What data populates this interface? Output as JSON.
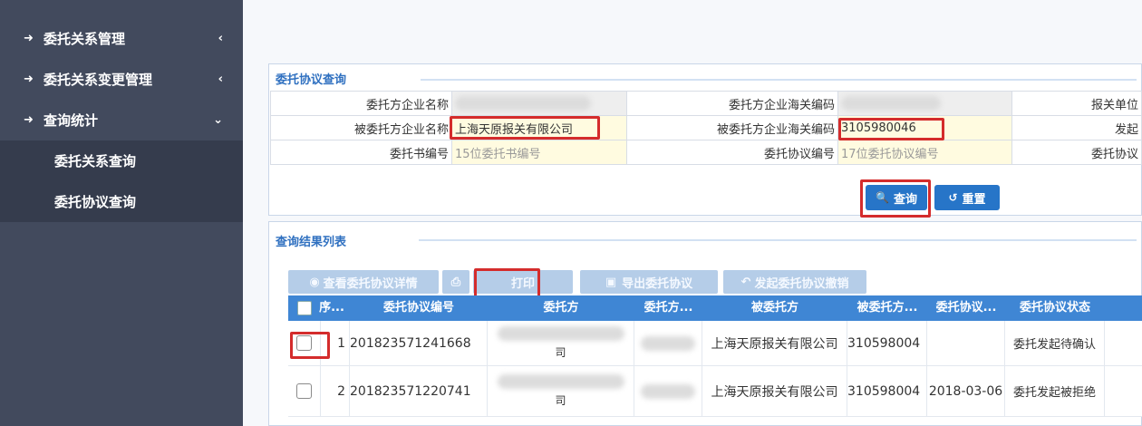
{
  "sidebar": {
    "items": [
      {
        "icon": "sign-in-icon",
        "label": "委托关系管理",
        "chevron": "‹"
      },
      {
        "icon": "sign-in-icon",
        "label": "委托关系变更管理",
        "chevron": "‹"
      },
      {
        "icon": "sign-in-icon",
        "label": "查询统计",
        "chevron": "⌄"
      }
    ],
    "subitems": [
      {
        "label": "委托关系查询"
      },
      {
        "label": "委托协议查询"
      }
    ]
  },
  "query_panel": {
    "title": "委托协议查询",
    "fields": {
      "r1": {
        "l1": "委托方企业名称",
        "l2": "委托方企业海关编码",
        "l3": "报关单位"
      },
      "r2": {
        "l1": "被委托方企业名称",
        "v1": "上海天原报关有限公司",
        "l2": "被委托方企业海关编码",
        "v2": "3105980046",
        "l3": "发起"
      },
      "r3": {
        "l1": "委托书编号",
        "p1": "15位委托书编号",
        "l2": "委托协议编号",
        "p2": "17位委托协议编号",
        "l3": "委托协议"
      }
    },
    "search_label": "查询",
    "reset_label": "重置"
  },
  "result_panel": {
    "title": "查询结果列表",
    "toolbar": {
      "view_detail": "查看委托协议详情",
      "print": "打印",
      "export": "导出委托协议",
      "revoke": "发起委托协议撤销"
    },
    "columns": [
      "序...",
      "委托协议编号",
      "委托方",
      "委托方...",
      "被委托方",
      "被委托方...",
      "委托协议...",
      "委托协议状态"
    ],
    "rows": [
      {
        "seq": "1",
        "agreement_no": "201823571241668",
        "consignor_frag": "司",
        "agent": "上海天原报关有限公司",
        "agent_code": "310598004",
        "date": "",
        "status": "委托发起待确认"
      },
      {
        "seq": "2",
        "agreement_no": "201823571220741",
        "consignor_frag": "司",
        "agent": "上海天原报关有限公司",
        "agent_code": "310598004",
        "date": "2018-03-06",
        "status": "委托发起被拒绝"
      }
    ]
  },
  "colors": {
    "sidebar_bg": "#424a5d",
    "submenu_bg": "#353c4d",
    "accent": "#2775c8",
    "grid_header": "#3f86d4",
    "highlight": "#d42c2c"
  }
}
